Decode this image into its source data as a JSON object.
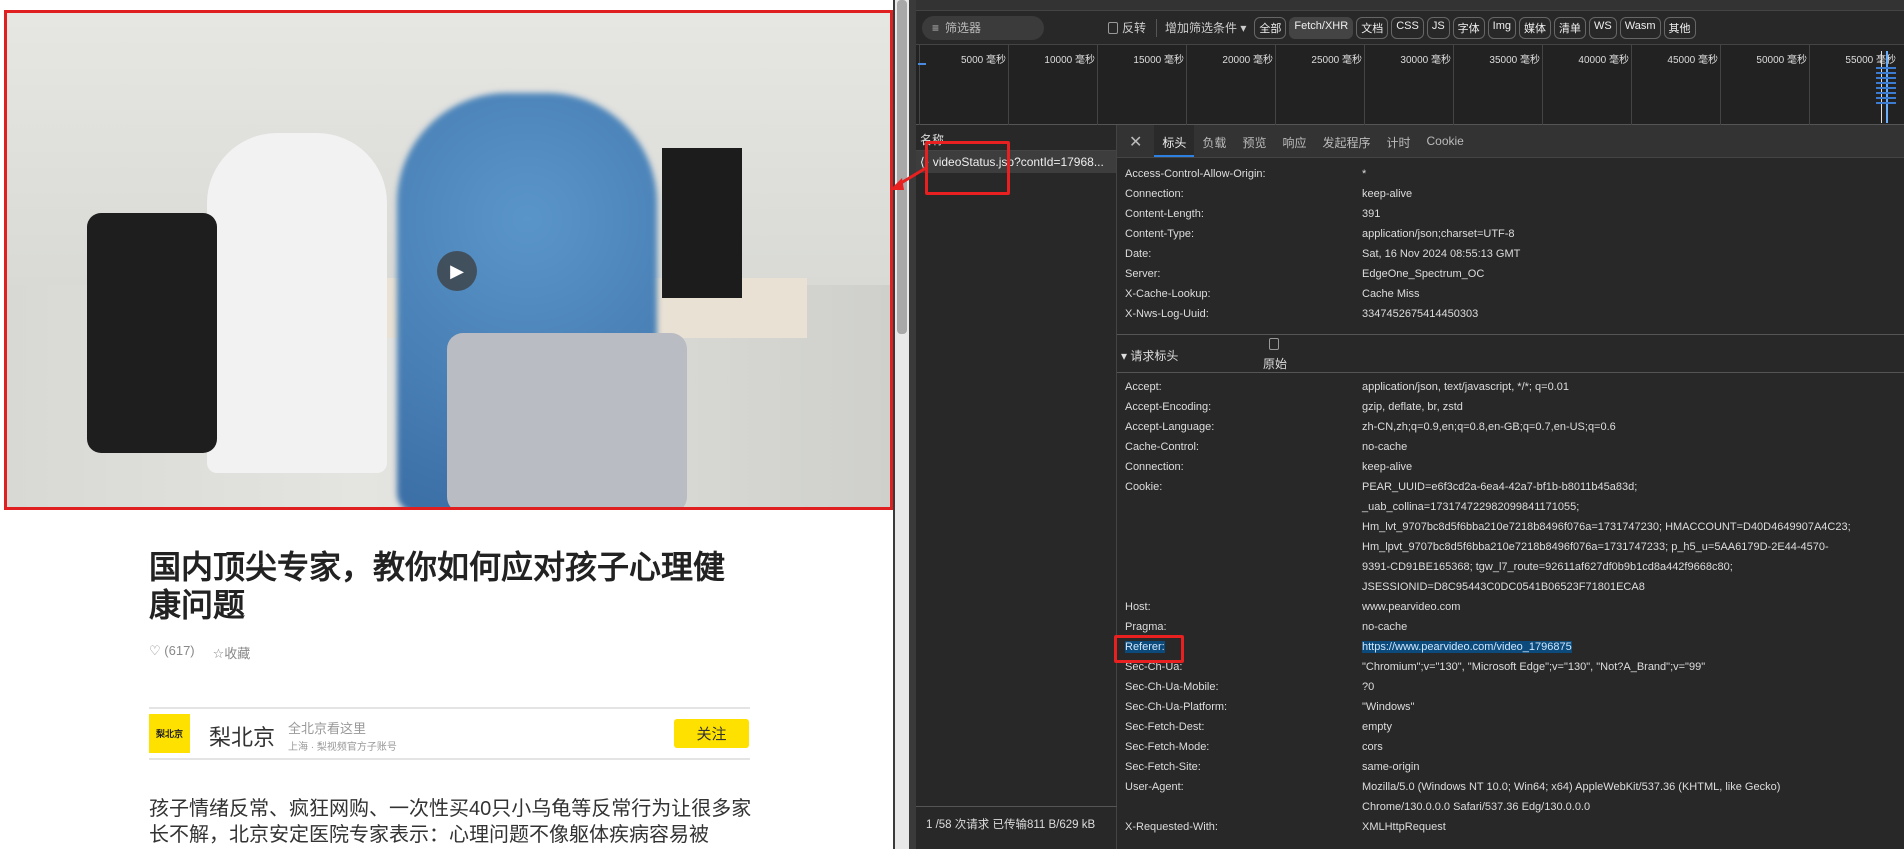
{
  "article": {
    "title": "国内顶尖专家，教你如何应对孩子心理健康问题",
    "likes": "(617)",
    "favorite_label": "收藏",
    "author": {
      "logo_text": "梨北京",
      "name": "梨北京",
      "slogan": "全北京看这里",
      "subtitle": "上海 · 梨视频官方子账号",
      "follow_label": "关注"
    },
    "body": "孩子情绪反常、疯狂网购、一次性买40只小乌龟等反常行为让很多家长不解，北京安定医院专家表示：心理问题不像躯体疾病容易被"
  },
  "devtools": {
    "filter_placeholder": "筛选器",
    "invert_label": "反转",
    "more_filters_label": "增加筛选条件",
    "type_filters": [
      "全部",
      "Fetch/XHR",
      "文档",
      "CSS",
      "JS",
      "字体",
      "Img",
      "媒体",
      "清单",
      "WS",
      "Wasm",
      "其他"
    ],
    "active_filter": "Fetch/XHR",
    "timeline_labels": [
      "5000 毫秒",
      "10000 毫秒",
      "15000 毫秒",
      "20000 毫秒",
      "25000 毫秒",
      "30000 毫秒",
      "35000 毫秒",
      "40000 毫秒",
      "45000 毫秒",
      "50000 毫秒",
      "55000 毫秒"
    ],
    "name_header": "名称",
    "request_name": "videoStatus.jsp?contId=17968...",
    "status_text": "1 /58 次请求   已传输811 B/629 kB",
    "tabs": [
      "标头",
      "负载",
      "预览",
      "响应",
      "发起程序",
      "计时",
      "Cookie"
    ],
    "active_tab": "标头",
    "response_headers": [
      {
        "k": "Access-Control-Allow-Origin:",
        "v": "*"
      },
      {
        "k": "Connection:",
        "v": "keep-alive"
      },
      {
        "k": "Content-Length:",
        "v": "391"
      },
      {
        "k": "Content-Type:",
        "v": "application/json;charset=UTF-8"
      },
      {
        "k": "Date:",
        "v": "Sat, 16 Nov 2024 08:55:13 GMT"
      },
      {
        "k": "Server:",
        "v": "EdgeOne_Spectrum_OC"
      },
      {
        "k": "X-Cache-Lookup:",
        "v": "Cache Miss"
      },
      {
        "k": "X-Nws-Log-Uuid:",
        "v": "3347452675414450303"
      }
    ],
    "request_section_label": "▾ 请求标头",
    "raw_label": "原始",
    "request_headers": [
      {
        "k": "Accept:",
        "v": [
          "application/json, text/javascript, */*; q=0.01"
        ]
      },
      {
        "k": "Accept-Encoding:",
        "v": [
          "gzip, deflate, br, zstd"
        ]
      },
      {
        "k": "Accept-Language:",
        "v": [
          "zh-CN,zh;q=0.9,en;q=0.8,en-GB;q=0.7,en-US;q=0.6"
        ]
      },
      {
        "k": "Cache-Control:",
        "v": [
          "no-cache"
        ]
      },
      {
        "k": "Connection:",
        "v": [
          "keep-alive"
        ]
      },
      {
        "k": "Cookie:",
        "v": [
          "PEAR_UUID=e6f3cd2a-6ea4-42a7-bf1b-b8011b45a83d;",
          "_uab_collina=173174722982099841171055;",
          "Hm_lvt_9707bc8d5f6bba210e7218b8496f076a=1731747230; HMACCOUNT=D40D4649907A4C23;",
          "Hm_lpvt_9707bc8d5f6bba210e7218b8496f076a=1731747233; p_h5_u=5AA6179D-2E44-4570-",
          "9391-CD91BE165368; tgw_l7_route=92611af627df0b9b1cd8a442f9668c80;",
          "JSESSIONID=D8C95443C0DC0541B06523F71801ECA8"
        ]
      },
      {
        "k": "Host:",
        "v": [
          "www.pearvideo.com"
        ]
      },
      {
        "k": "Pragma:",
        "v": [
          "no-cache"
        ]
      },
      {
        "k": "Referer:",
        "v": [
          "https://www.pearvideo.com/video_1796875"
        ],
        "selected": true
      },
      {
        "k": "Sec-Ch-Ua:",
        "v": [
          "\"Chromium\";v=\"130\", \"Microsoft Edge\";v=\"130\", \"Not?A_Brand\";v=\"99\""
        ]
      },
      {
        "k": "Sec-Ch-Ua-Mobile:",
        "v": [
          "?0"
        ]
      },
      {
        "k": "Sec-Ch-Ua-Platform:",
        "v": [
          "\"Windows\""
        ]
      },
      {
        "k": "Sec-Fetch-Dest:",
        "v": [
          "empty"
        ]
      },
      {
        "k": "Sec-Fetch-Mode:",
        "v": [
          "cors"
        ]
      },
      {
        "k": "Sec-Fetch-Site:",
        "v": [
          "same-origin"
        ]
      },
      {
        "k": "User-Agent:",
        "v": [
          "Mozilla/5.0 (Windows NT 10.0; Win64; x64) AppleWebKit/537.36 (KHTML, like Gecko)",
          "Chrome/130.0.0.0 Safari/537.36 Edg/130.0.0.0"
        ]
      },
      {
        "k": "X-Requested-With:",
        "v": [
          "XMLHttpRequest"
        ]
      }
    ]
  },
  "colors": {
    "accent": "#ffe100",
    "annotation_red": "#e82020",
    "devtools_bg": "#282828",
    "selection": "#0b4a7a"
  }
}
